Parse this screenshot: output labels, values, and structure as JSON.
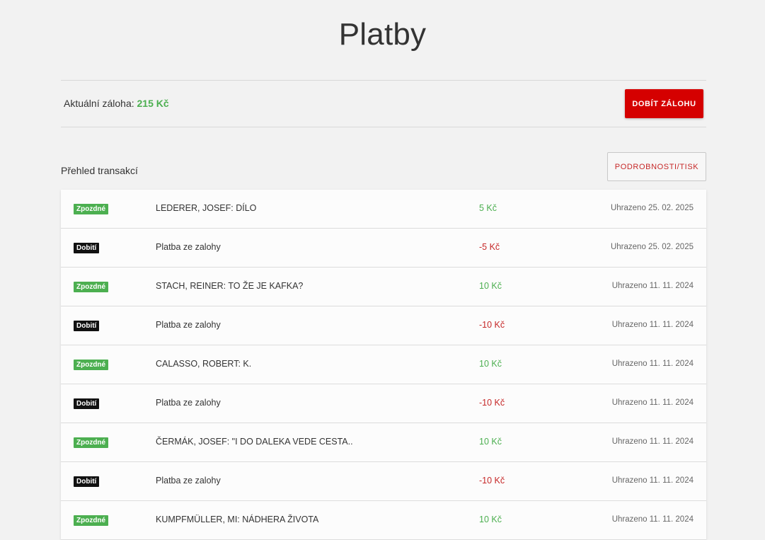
{
  "page": {
    "title": "Platby"
  },
  "balance": {
    "label": "Aktuální záloha:",
    "amount": "215 Kč",
    "topup_label": "DOBÍT ZÁLOHU"
  },
  "transactions": {
    "title": "Přehled transakcí",
    "details_label": "PODROBNOSTI/TISK",
    "rows": [
      {
        "badge": "Zpozdné",
        "type": "late",
        "description": "LEDERER, JOSEF: DÍLO",
        "amount": "5 Kč",
        "sign": "pos",
        "status": "Uhrazeno 25. 02. 2025"
      },
      {
        "badge": "Dobití",
        "type": "topup",
        "description": "Platba ze zalohy",
        "amount": "-5 Kč",
        "sign": "neg",
        "status": "Uhrazeno 25. 02. 2025"
      },
      {
        "badge": "Zpozdné",
        "type": "late",
        "description": "STACH, REINER: TO ŽE JE KAFKA?",
        "amount": "10 Kč",
        "sign": "pos",
        "status": "Uhrazeno 11. 11. 2024"
      },
      {
        "badge": "Dobití",
        "type": "topup",
        "description": "Platba ze zalohy",
        "amount": "-10 Kč",
        "sign": "neg",
        "status": "Uhrazeno 11. 11. 2024"
      },
      {
        "badge": "Zpozdné",
        "type": "late",
        "description": "CALASSO, ROBERT: K.",
        "amount": "10 Kč",
        "sign": "pos",
        "status": "Uhrazeno 11. 11. 2024"
      },
      {
        "badge": "Dobití",
        "type": "topup",
        "description": "Platba ze zalohy",
        "amount": "-10 Kč",
        "sign": "neg",
        "status": "Uhrazeno 11. 11. 2024"
      },
      {
        "badge": "Zpozdné",
        "type": "late",
        "description": "ČERMÁK, JOSEF: \"I DO DALEKA VEDE CESTA..",
        "amount": "10 Kč",
        "sign": "pos",
        "status": "Uhrazeno 11. 11. 2024"
      },
      {
        "badge": "Dobití",
        "type": "topup",
        "description": "Platba ze zalohy",
        "amount": "-10 Kč",
        "sign": "neg",
        "status": "Uhrazeno 11. 11. 2024"
      },
      {
        "badge": "Zpozdné",
        "type": "late",
        "description": "KUMPFMÜLLER, MI: NÁDHERA ŽIVOTA",
        "amount": "10 Kč",
        "sign": "pos",
        "status": "Uhrazeno 11. 11. 2024"
      }
    ]
  },
  "colors": {
    "positive": "#4caf50",
    "negative": "#c62828",
    "accent": "#d50000",
    "badge_topup": "#111111"
  }
}
